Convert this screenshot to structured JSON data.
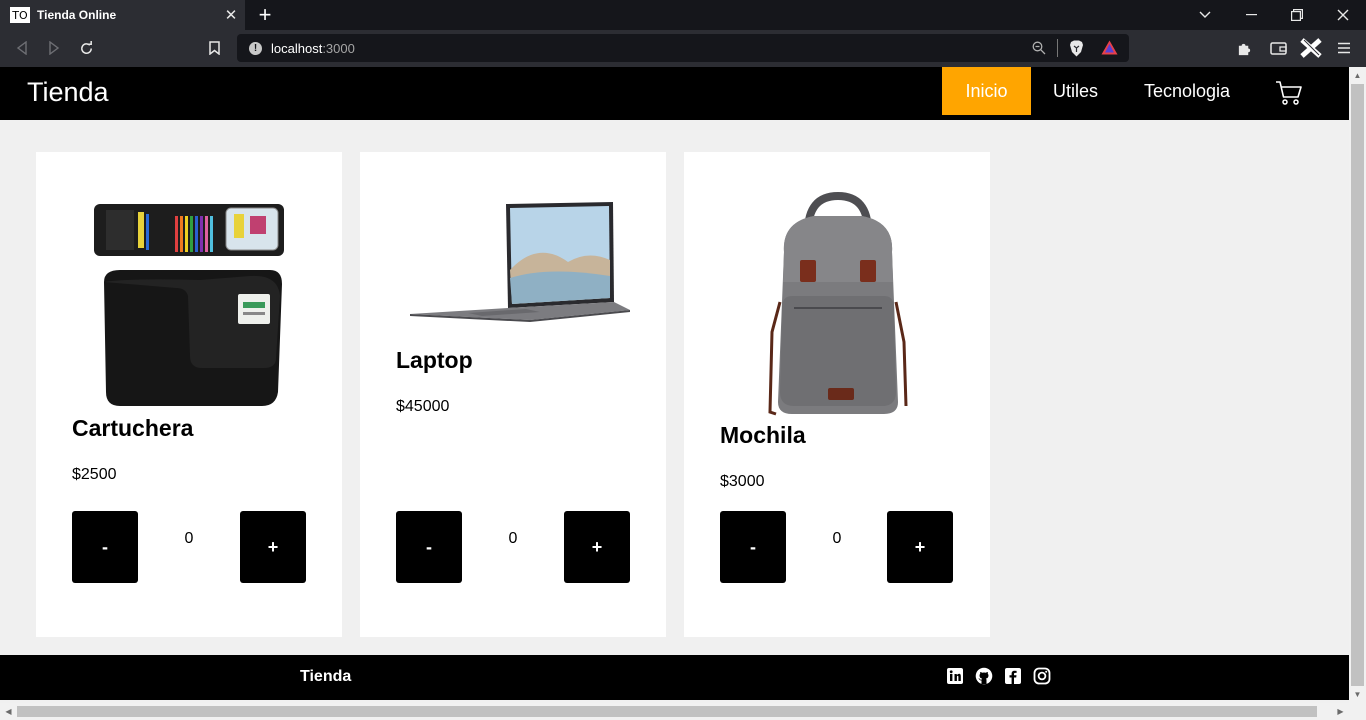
{
  "browser": {
    "tab_favicon": "TO",
    "tab_title": "Tienda Online",
    "tab_close": "✕",
    "new_tab": "+",
    "url_host": "localhost",
    "url_port": ":3000",
    "url_info": "!"
  },
  "navbar": {
    "brand": "Tienda",
    "links": [
      {
        "label": "Inicio",
        "active": true
      },
      {
        "label": "Utiles",
        "active": false
      },
      {
        "label": "Tecnologia",
        "active": false
      }
    ],
    "accent_color": "#ffa500"
  },
  "products": [
    {
      "name": "Cartuchera",
      "price": "$2500",
      "quantity": "0",
      "minus": "-",
      "plus": "+",
      "image": "pencil-case"
    },
    {
      "name": "Laptop",
      "price": "$45000",
      "quantity": "0",
      "minus": "-",
      "plus": "+",
      "image": "laptop"
    },
    {
      "name": "Mochila",
      "price": "$3000",
      "quantity": "0",
      "minus": "-",
      "plus": "+",
      "image": "backpack"
    }
  ],
  "footer": {
    "brand": "Tienda",
    "social": [
      "linkedin-icon",
      "github-icon",
      "facebook-icon",
      "instagram-icon"
    ]
  }
}
